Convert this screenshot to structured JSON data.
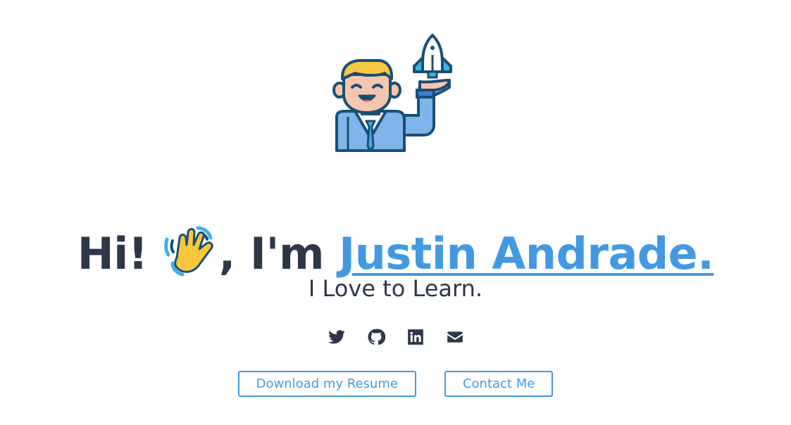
{
  "hero": {
    "greeting_prefix": "Hi! ",
    "greeting_middle": ", I'm ",
    "name": "Justin Andrade.",
    "tagline": "I Love to Learn."
  },
  "socials": [
    {
      "icon": "twitter-icon"
    },
    {
      "icon": "github-icon"
    },
    {
      "icon": "linkedin-icon"
    },
    {
      "icon": "email-icon"
    }
  ],
  "actions": {
    "resume_label": "Download my Resume",
    "contact_label": "Contact Me"
  },
  "colors": {
    "accent": "#4299e1",
    "text": "#2d3748",
    "background": "#ffffff"
  }
}
